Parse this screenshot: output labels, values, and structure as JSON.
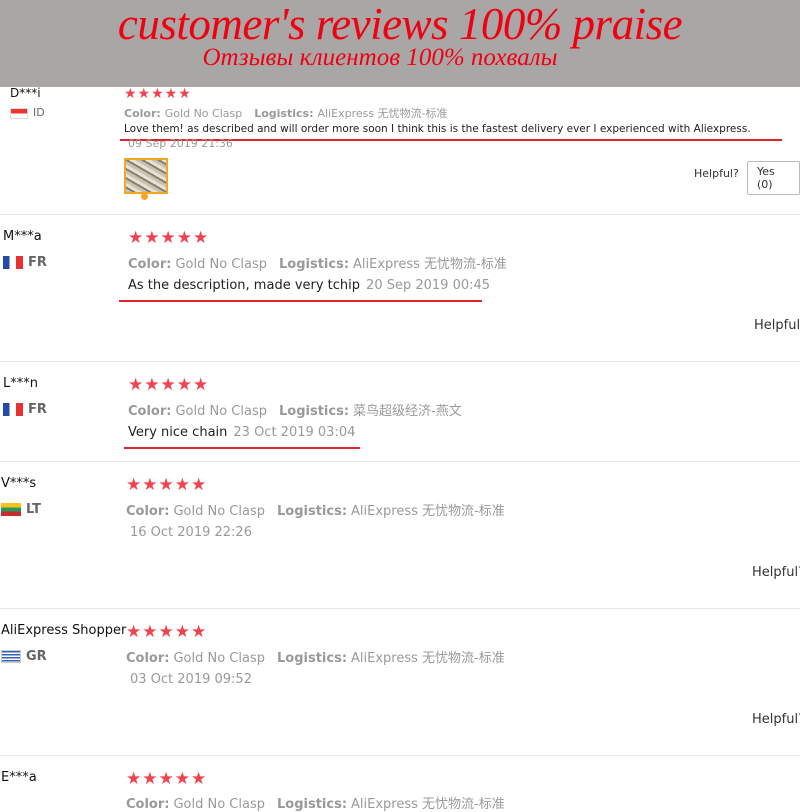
{
  "banner": {
    "title": "customer's reviews    100% praise",
    "subtitle": "Отзывы клиентов   100% похвалы"
  },
  "labels": {
    "color": "Color:",
    "logistics": "Logistics:",
    "helpful": "Helpful?",
    "helpful_short": "Helpful",
    "yes_button": "Yes (0)",
    "stars": "★★★★★"
  },
  "reviews": [
    {
      "name": "D***i",
      "country": "ID",
      "color_value": "Gold No Clasp",
      "logistics_value": "AliExpress 无忧物流-标准",
      "text": "Love them! as described and will order more soon I think this is the fastest delivery ever I experienced with Aliexpress.",
      "date": "09 Sep 2019 21:36"
    },
    {
      "name": "M***a",
      "country": "FR",
      "color_value": "Gold No Clasp",
      "logistics_value": "AliExpress 无忧物流-标准",
      "text": "As the description, made very tchip",
      "date": "20 Sep 2019 00:45"
    },
    {
      "name": "L***n",
      "country": "FR",
      "color_value": "Gold No Clasp",
      "logistics_value": "菜鸟超级经济-燕文",
      "text": "Very nice chain",
      "date": "23 Oct 2019 03:04"
    },
    {
      "name": "V***s",
      "country": "LT",
      "color_value": "Gold No Clasp",
      "logistics_value": "AliExpress 无忧物流-标准",
      "text": "",
      "date": "16 Oct 2019 22:26"
    },
    {
      "name": "AliExpress Shopper",
      "country": "GR",
      "color_value": "Gold No Clasp",
      "logistics_value": "AliExpress 无忧物流-标准",
      "text": "",
      "date": "03 Oct 2019 09:52"
    },
    {
      "name": "E***a",
      "country": "",
      "color_value": "Gold No Clasp",
      "logistics_value": "AliExpress 无忧物流-标准",
      "text": "",
      "date": ""
    }
  ],
  "colors": {
    "accent": "#f00012",
    "star": "#f04350",
    "underline": "#e4212f"
  }
}
